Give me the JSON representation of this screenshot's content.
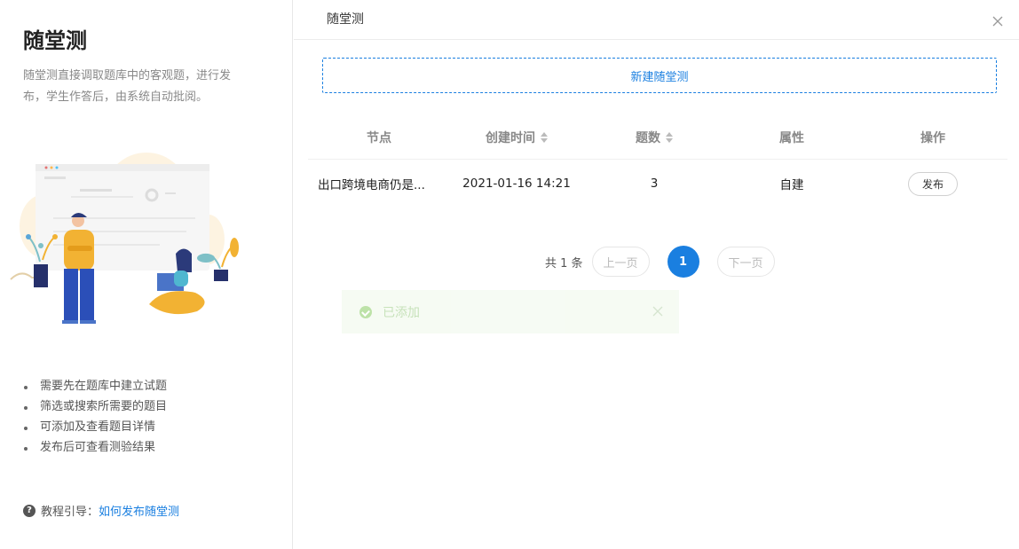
{
  "left": {
    "title": "随堂测",
    "description": "随堂测直接调取题库中的客观题，进行发布，学生作答后，由系统自动批阅。",
    "tips": [
      "需要先在题库中建立试题",
      "筛选或搜索所需要的题目",
      "可添加及查看题目详情",
      "发布后可查看测验结果"
    ],
    "guide_label": "教程引导：",
    "guide_link": "如何发布随堂测"
  },
  "panel": {
    "title": "随堂测",
    "new_button": "新建随堂测"
  },
  "table": {
    "headers": [
      "节点",
      "创建时间",
      "题数",
      "属性",
      "操作"
    ],
    "rows": [
      {
        "node": "出口跨境电商仍是...",
        "created": "2021-01-16 14:21",
        "count": "3",
        "attr": "自建",
        "action": "发布"
      }
    ]
  },
  "pagination": {
    "total": "共 1 条",
    "prev": "上一页",
    "current": "1",
    "next": "下一页"
  },
  "toast": {
    "text": "已添加"
  },
  "colors": {
    "accent": "#1a7fe0",
    "success": "#a8d98c"
  }
}
